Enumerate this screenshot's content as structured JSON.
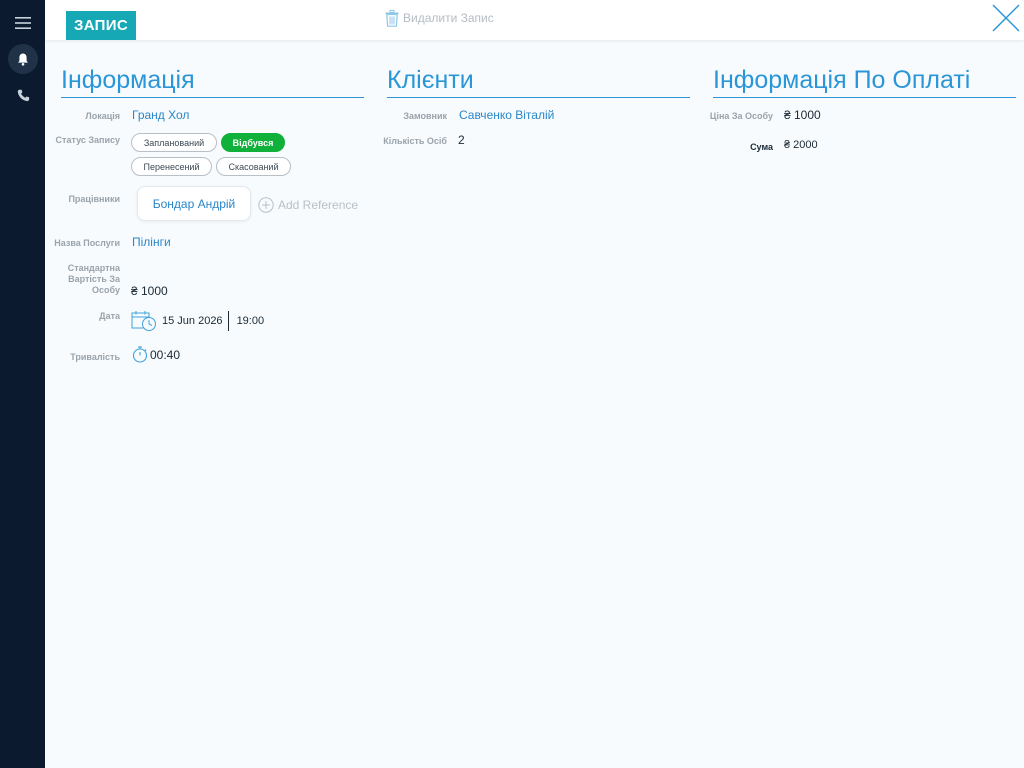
{
  "header": {
    "title": "ЗАПИС",
    "delete_label": "Видалити Запис"
  },
  "info": {
    "title": "Інформація",
    "location_label": "Локація",
    "location_value": "Гранд Хол",
    "status_label": "Статус Запису",
    "status_options": [
      "Запланований",
      "Відбувся",
      "Перенесений",
      "Скасований"
    ],
    "status_selected": "Відбувся",
    "workers_label": "Працівники",
    "worker": "Бондар Андрій",
    "add_reference": "Add Reference",
    "service_label": "Назва Послуги",
    "service_value": "Пілінги",
    "std_price_label": "Стандартна Вартість За Особу",
    "std_price_value": "₴ 1000",
    "date_label": "Дата",
    "date_value": "15 Jun 2026",
    "time_value": "19:00",
    "duration_label": "Тривалість",
    "duration_value": "00:40"
  },
  "clients": {
    "title": "Клієнти",
    "customer_label": "Замовник",
    "customer_value": "Савченко Віталій",
    "persons_label": "Кількість Осіб",
    "persons_value": "2"
  },
  "payment": {
    "title": "Інформація По Оплаті",
    "price_label": "Ціна За Особу",
    "price_value": "₴ 1000",
    "sum_label": "Сума",
    "sum_value": "₴ 2000"
  },
  "colors": {
    "accent": "#2a96d8",
    "badge": "#16a8b5",
    "status_active": "#10b13a",
    "rail": "#0b1a2e"
  }
}
